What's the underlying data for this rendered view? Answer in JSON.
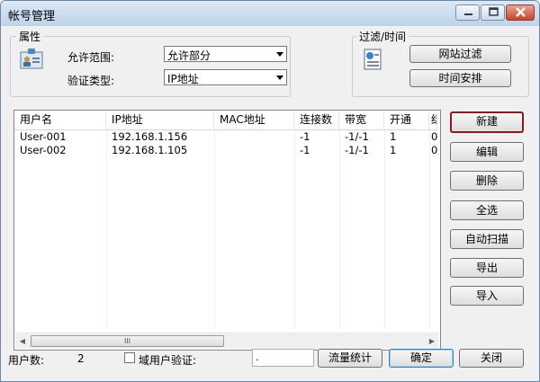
{
  "window": {
    "title": "帐号管理"
  },
  "attributes": {
    "legend": "属性",
    "range_label": "允许范围:",
    "range_value": "允许部分",
    "type_label": "验证类型:",
    "type_value": "IP地址"
  },
  "filter": {
    "legend": "过滤/时间",
    "web_filter_label": "网站过滤",
    "schedule_label": "时间安排"
  },
  "table": {
    "columns": [
      "用户名",
      "IP地址",
      "MAC地址",
      "连接数",
      "带宽",
      "开通",
      "结"
    ],
    "rows": [
      [
        "User-001",
        "192.168.1.156",
        "",
        "-1",
        "-1/-1",
        "1",
        "0"
      ],
      [
        "User-002",
        "192.168.1.105",
        "",
        "-1",
        "-1/-1",
        "1",
        "0"
      ]
    ],
    "scroll_thumb_glyph": "III"
  },
  "side_buttons": {
    "new_label": "新建",
    "edit_label": "编辑",
    "delete_label": "删除",
    "select_all_label": "全选",
    "auto_scan_label": "自动扫描",
    "export_label": "导出",
    "import_label": "导入"
  },
  "footer": {
    "user_count_label": "用户数:",
    "user_count_value": "2",
    "domain_verify_label": "域用户验证:",
    "domain_field_value": ".",
    "traffic_stats_label": "流量统计",
    "ok_label": "确定",
    "close_label": "关闭"
  }
}
